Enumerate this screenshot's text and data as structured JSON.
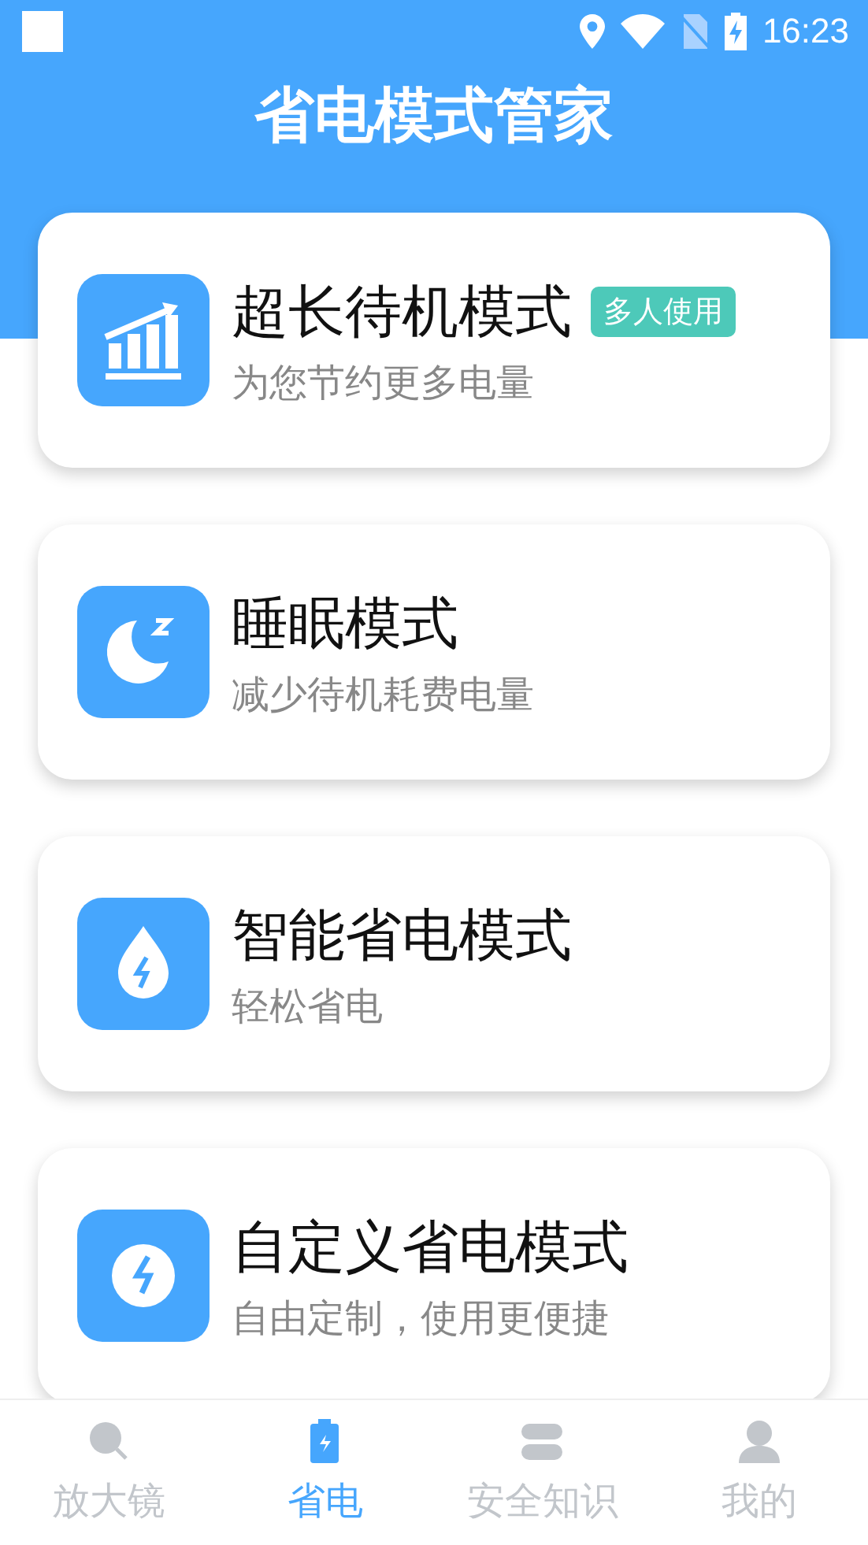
{
  "status_bar": {
    "time": "16:23"
  },
  "header": {
    "title": "省电模式管家"
  },
  "modes": [
    {
      "title": "超长待机模式",
      "subtitle": "为您节约更多电量",
      "badge": "多人使用"
    },
    {
      "title": "睡眠模式",
      "subtitle": "减少待机耗费电量"
    },
    {
      "title": "智能省电模式",
      "subtitle": "轻松省电"
    },
    {
      "title": "自定义省电模式",
      "subtitle": "自由定制，使用更便捷"
    }
  ],
  "tab_bar": [
    {
      "label": "放大镜",
      "selected": false
    },
    {
      "label": "省电",
      "selected": true
    },
    {
      "label": "安全知识",
      "selected": false
    },
    {
      "label": "我的",
      "selected": false
    }
  ]
}
